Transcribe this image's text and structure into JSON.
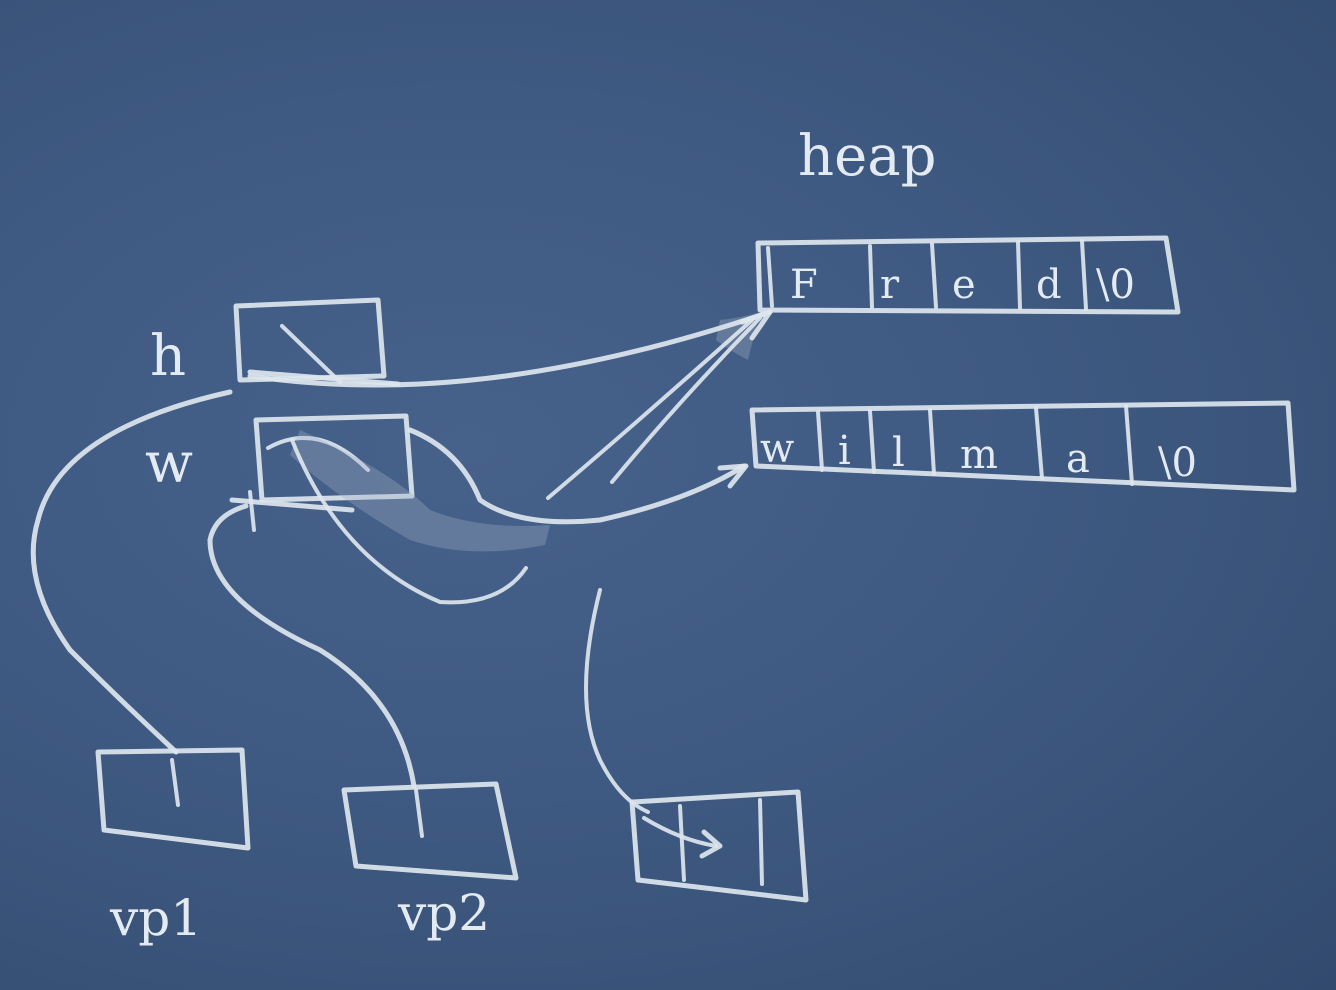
{
  "labels": {
    "heap": "heap",
    "h": "h",
    "w": "w",
    "vp1": "vp1",
    "vp2": "vp2"
  },
  "heap_strings": [
    {
      "name": "fred",
      "cells": [
        "F",
        "r",
        "e",
        "d",
        "\\0"
      ]
    },
    {
      "name": "wilma",
      "cells": [
        "w",
        "i",
        "l",
        "m",
        "a",
        "\\0"
      ]
    }
  ],
  "colors": {
    "board": "#3e587f",
    "chalk": "#dde6ee"
  }
}
